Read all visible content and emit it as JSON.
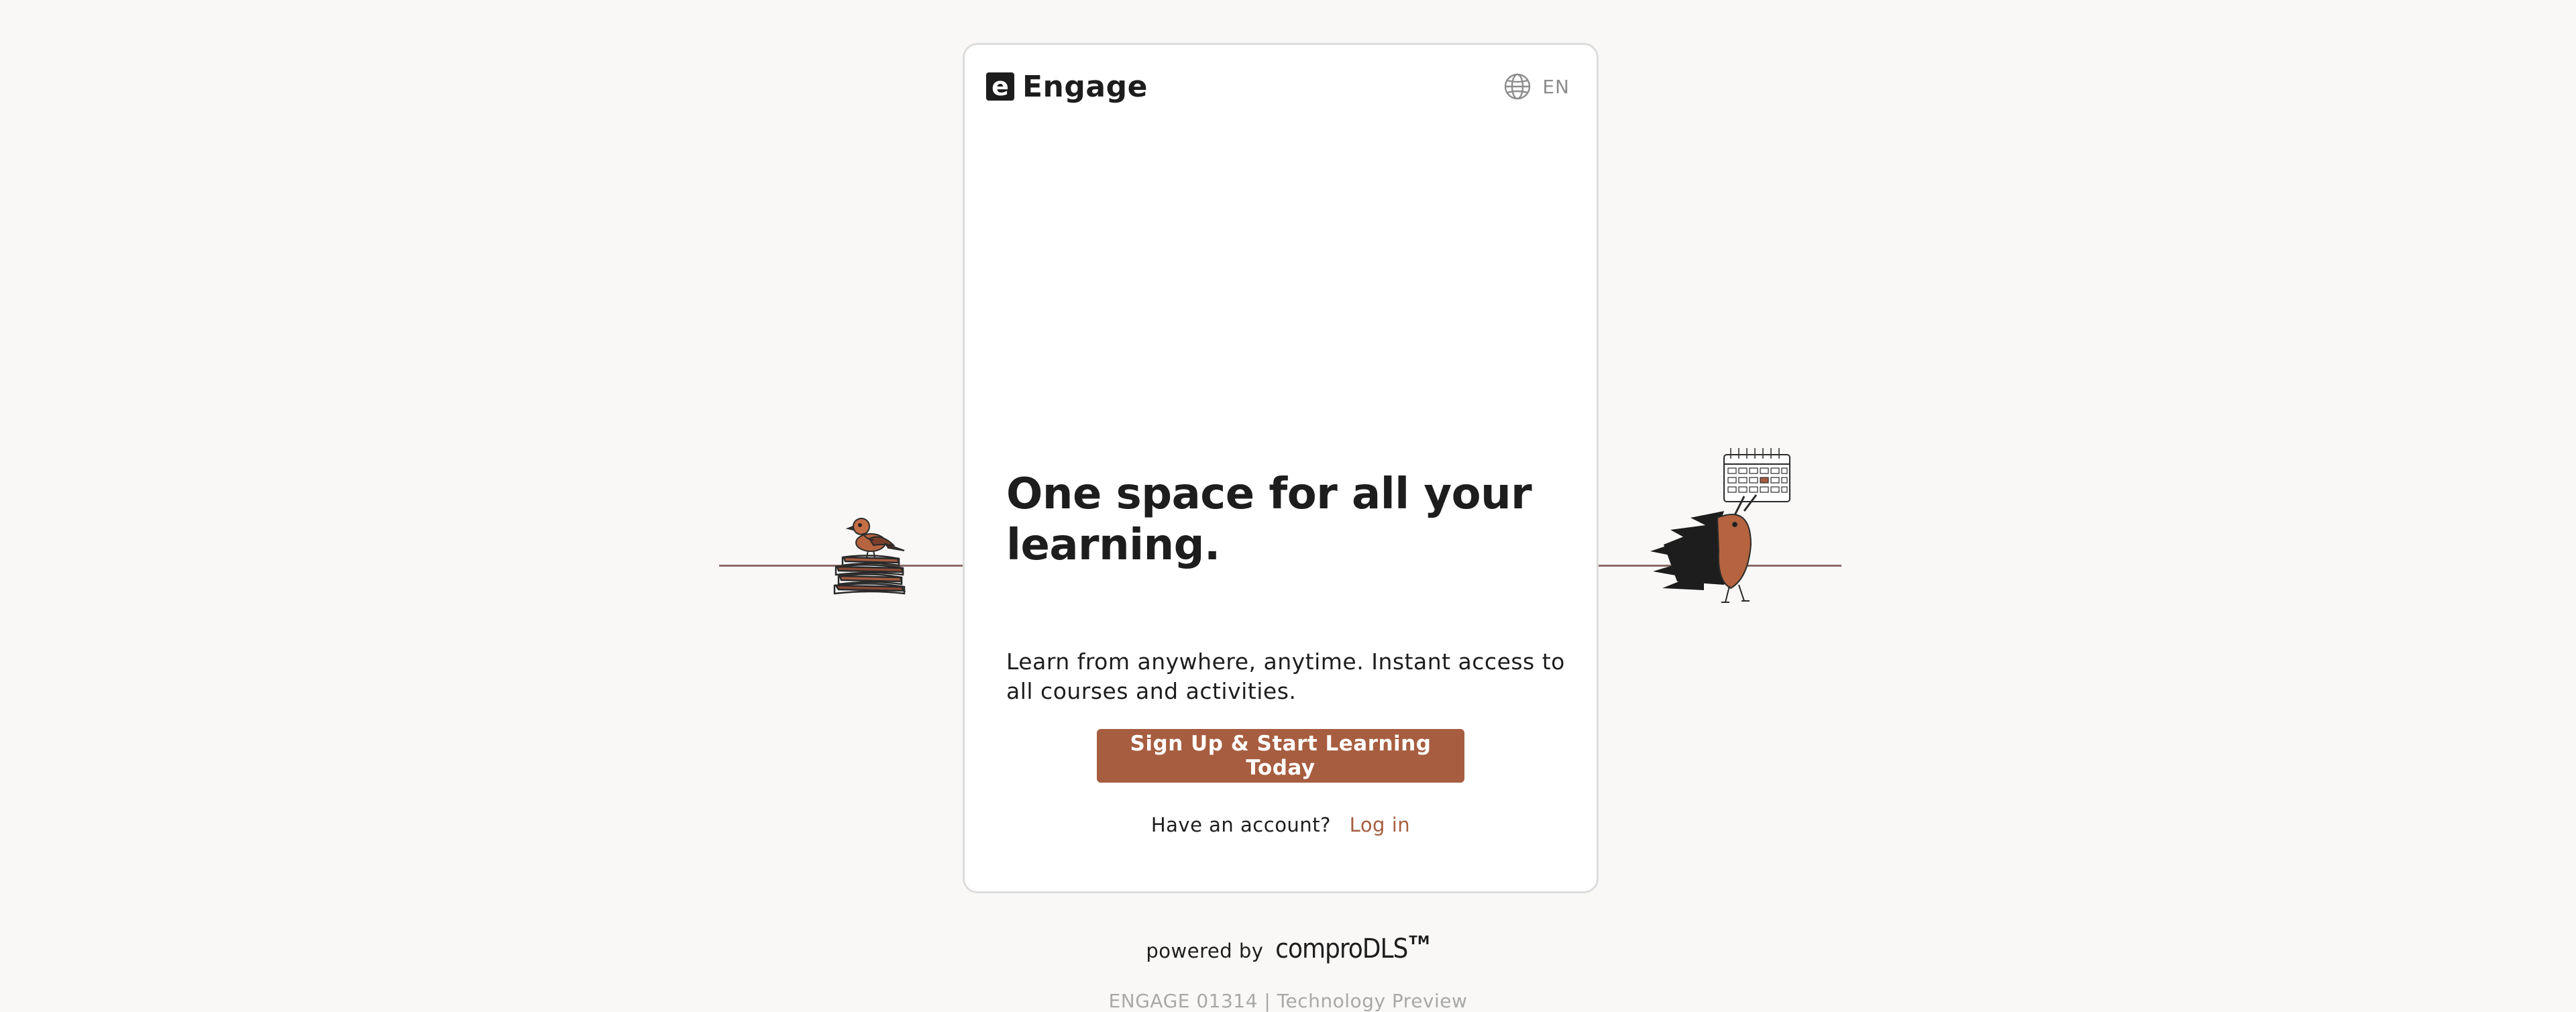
{
  "brand": {
    "name": "Engage",
    "mark_letter": "e"
  },
  "language": {
    "code": "EN",
    "icon": "globe-icon"
  },
  "hero": {
    "headline": "One space for all your learning.",
    "subtext": "Learn from anywhere, anytime. Instant access to all courses and activities."
  },
  "cta": {
    "label": "Sign Up & Start Learning Today"
  },
  "login": {
    "prompt": "Have an account?",
    "link_label": "Log in"
  },
  "footer": {
    "powered_prefix": "powered by",
    "powered_brand": "comproDLS",
    "trademark": "TM",
    "version": "ENGAGE 01314 | Technology Preview"
  },
  "colors": {
    "accent": "#a75d40",
    "background": "#f9f8f7",
    "card": "#ffffff",
    "text": "#1d1d1d",
    "muted": "#8c8c8c",
    "ground_line": "#8a6b65"
  },
  "illustrations": {
    "left": "books-with-bird-illustration",
    "right": "hedgehog-holding-calendar-illustration"
  }
}
